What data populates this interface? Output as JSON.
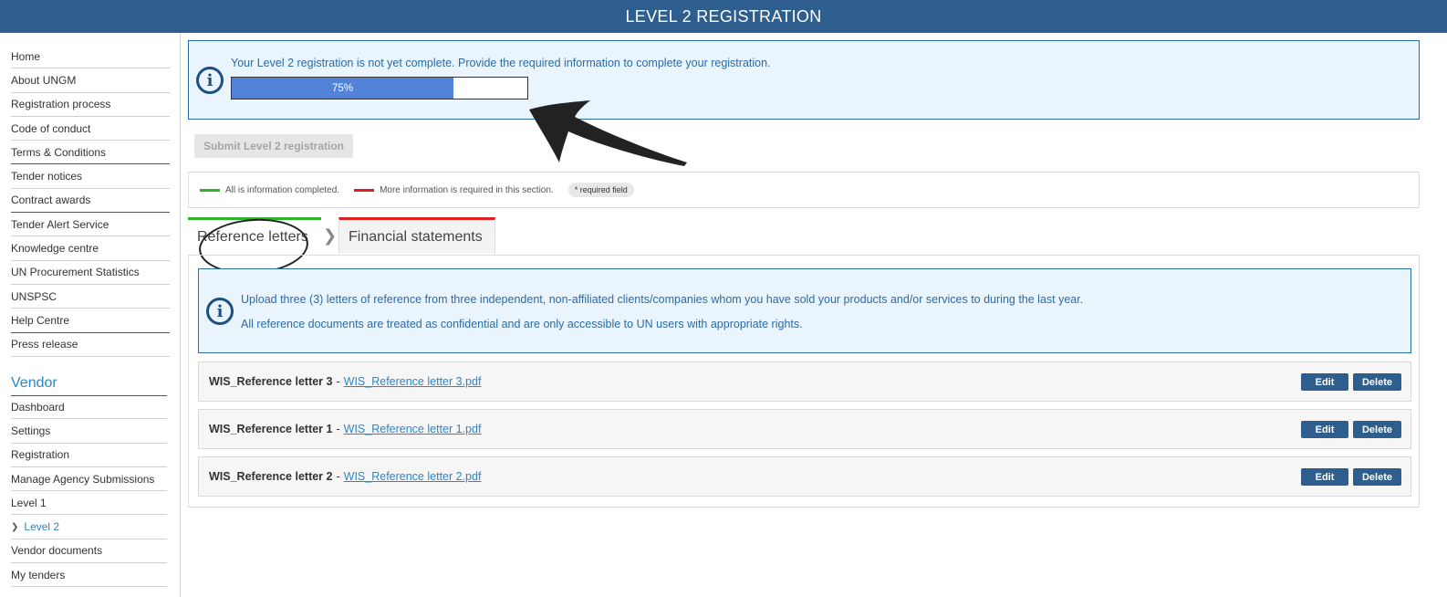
{
  "header": {
    "title": "LEVEL 2 REGISTRATION"
  },
  "sidebar": {
    "items": [
      {
        "label": "Home"
      },
      {
        "label": "About UNGM"
      },
      {
        "label": "Registration process"
      },
      {
        "label": "Code of conduct"
      },
      {
        "label": "Terms & Conditions"
      },
      {
        "label": "Tender notices"
      },
      {
        "label": "Contract awards"
      },
      {
        "label": "Tender Alert Service"
      },
      {
        "label": "Knowledge centre"
      },
      {
        "label": "UN Procurement Statistics"
      },
      {
        "label": "UNSPSC"
      },
      {
        "label": "Help Centre"
      },
      {
        "label": "Press release"
      }
    ],
    "vendor_heading": "Vendor",
    "vendor_items": [
      {
        "label": "Dashboard"
      },
      {
        "label": "Settings"
      },
      {
        "label": "Registration"
      },
      {
        "label": "Manage Agency Submissions"
      },
      {
        "label": "Level 1"
      },
      {
        "label": "Level 2"
      },
      {
        "label": "Vendor documents"
      },
      {
        "label": "My tenders"
      }
    ]
  },
  "alert": {
    "message": "Your Level 2 registration is not yet complete. Provide the required information to complete your registration.",
    "progress_label": "75%",
    "progress_value": 0.75
  },
  "submit_button": "Submit Level 2 registration",
  "legend": {
    "complete": "All is information completed.",
    "incomplete": "More information is required in this section.",
    "required": "* required field",
    "complete_color": "#2db52d",
    "incomplete_color": "#e02020"
  },
  "tabs": [
    {
      "label": "Reference letters",
      "status": "complete"
    },
    {
      "label": "Financial statements",
      "status": "incomplete"
    }
  ],
  "info": {
    "line1": "Upload three (3) letters of reference from three independent, non-affiliated clients/companies whom you have sold your products and/or services to during the last year.",
    "line2": "All reference documents are treated as confidential and are only accessible to UN users with appropriate rights."
  },
  "documents": [
    {
      "name": "WIS_Reference letter 3",
      "file": "WIS_Reference letter 3.pdf"
    },
    {
      "name": "WIS_Reference letter 1",
      "file": "WIS_Reference letter 1.pdf"
    },
    {
      "name": "WIS_Reference letter 2",
      "file": "WIS_Reference letter 2.pdf"
    }
  ],
  "doc_actions": {
    "edit": "Edit",
    "delete": "Delete"
  }
}
